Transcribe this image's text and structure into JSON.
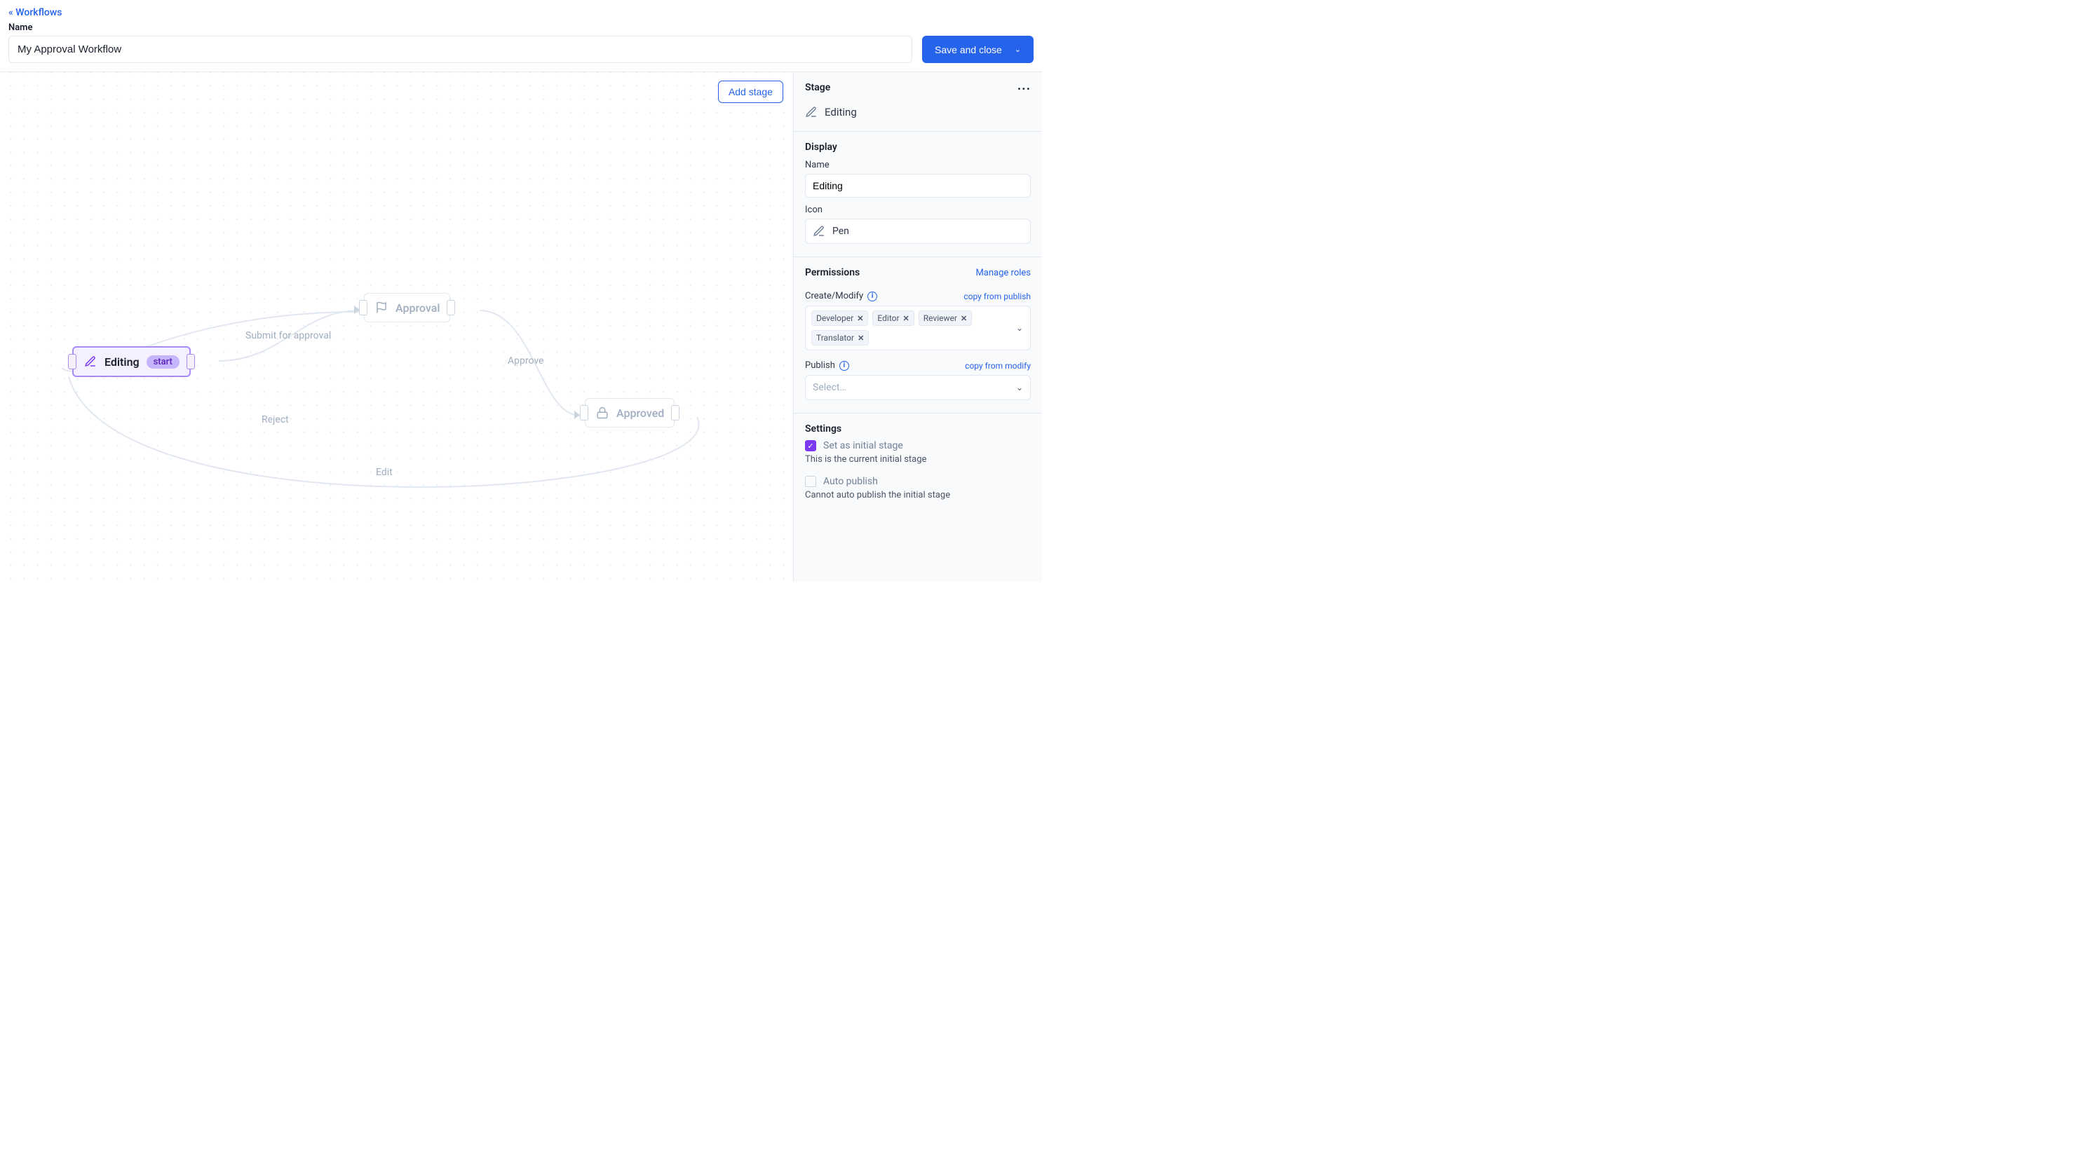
{
  "header": {
    "back_link": "« Workflows",
    "name_label": "Name",
    "workflow_name": "My Approval Workflow",
    "save_label": "Save and close"
  },
  "canvas": {
    "add_stage": "Add stage",
    "nodes": {
      "editing": {
        "label": "Editing",
        "badge": "start"
      },
      "approval": {
        "label": "Approval"
      },
      "approved": {
        "label": "Approved"
      }
    },
    "edges": {
      "submit": "Submit for approval",
      "approve": "Approve",
      "reject": "Reject",
      "edit": "Edit"
    }
  },
  "panel": {
    "stage_section_title": "Stage",
    "stage_name": "Editing",
    "display_title": "Display",
    "name_label": "Name",
    "name_value": "Editing",
    "icon_label": "Icon",
    "icon_value": "Pen",
    "permissions_title": "Permissions",
    "manage_roles": "Manage roles",
    "create_modify_label": "Create/Modify",
    "copy_from_publish": "copy from publish",
    "roles": [
      "Developer",
      "Editor",
      "Reviewer",
      "Translator"
    ],
    "publish_label": "Publish",
    "copy_from_modify": "copy from modify",
    "publish_placeholder": "Select…",
    "settings_title": "Settings",
    "set_initial_label": "Set as initial stage",
    "set_initial_help": "This is the current initial stage",
    "auto_publish_label": "Auto publish",
    "auto_publish_help": "Cannot auto publish the initial stage"
  }
}
